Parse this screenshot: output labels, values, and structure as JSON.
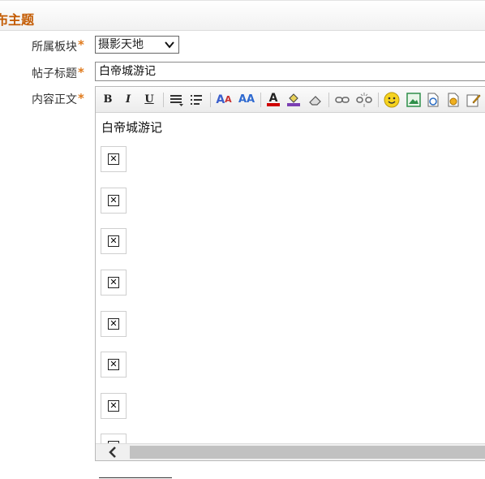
{
  "header": {
    "title": "布主题"
  },
  "form": {
    "board_label": "所属板块",
    "title_label": "帖子标题",
    "content_label": "内容正文",
    "required_mark": "*",
    "board_value": "摄影天地",
    "title_value": "白帝城游记"
  },
  "editor": {
    "toolbar": [
      {
        "name": "bold-button",
        "icon": "B"
      },
      {
        "name": "italic-button",
        "icon": "I"
      },
      {
        "name": "underline-button",
        "icon": "U"
      },
      {
        "name": "align-button",
        "icon": "align-icon"
      },
      {
        "name": "list-button",
        "icon": "list-icon"
      },
      {
        "name": "font-family-button",
        "icon": "font-family-icon"
      },
      {
        "name": "font-size-button",
        "icon": "font-size-icon"
      },
      {
        "name": "font-color-button",
        "icon": "font-color-icon"
      },
      {
        "name": "highlight-color-button",
        "icon": "paint-bucket-icon"
      },
      {
        "name": "eraser-button",
        "icon": "eraser-icon"
      },
      {
        "name": "link-button",
        "icon": "link-icon"
      },
      {
        "name": "unlink-button",
        "icon": "unlink-icon"
      },
      {
        "name": "emoticon-button",
        "icon": "smiley-icon"
      },
      {
        "name": "image-button",
        "icon": "image-icon"
      },
      {
        "name": "flash-button",
        "icon": "flash-icon"
      },
      {
        "name": "media-button",
        "icon": "media-icon"
      },
      {
        "name": "edit-button",
        "icon": "edit-icon"
      }
    ],
    "content_text": "白帝城游记",
    "image_placeholder_count": 8,
    "image_placeholder_glyph": "✕"
  },
  "colors": {
    "accent": "#c35a00",
    "required": "#e07a1c",
    "font_color_bar": "#d00000",
    "highlight_bar": "#7b3fb3"
  }
}
